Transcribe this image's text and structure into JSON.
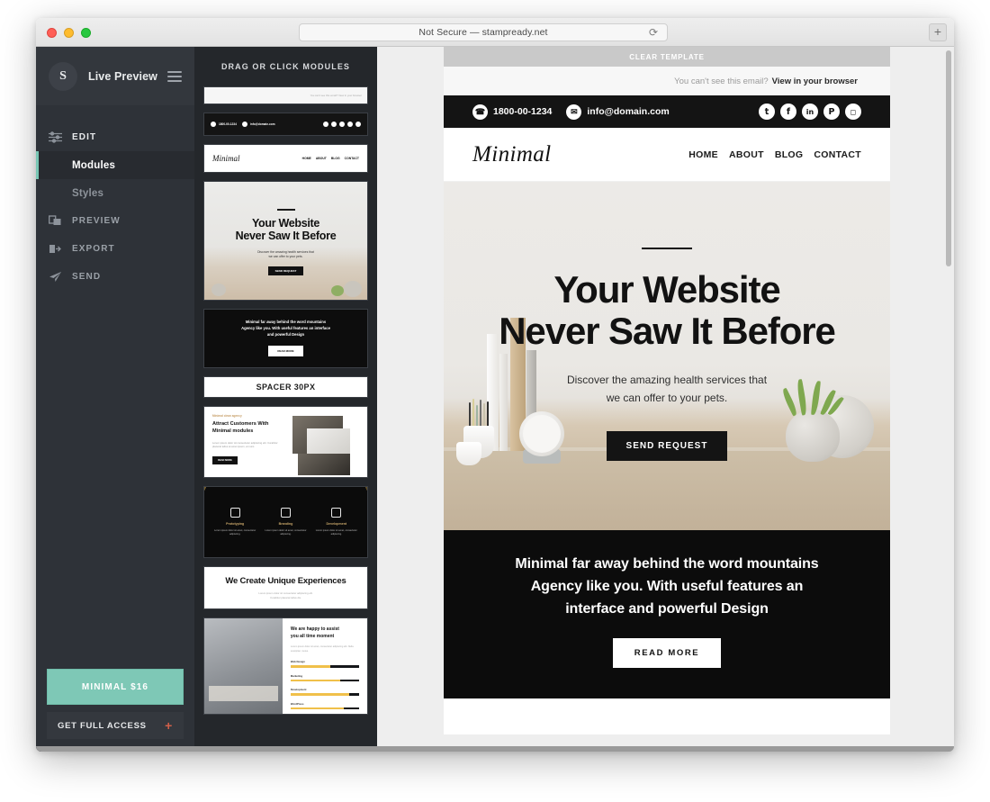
{
  "browser": {
    "url_text": "Not Secure — stampready.net",
    "reload_icon": "reload-icon",
    "newtab_label": "+"
  },
  "sidebar": {
    "brand": {
      "avatar_letter": "S",
      "title": "Live Preview",
      "menu_icon": "hamburger-icon"
    },
    "nav": [
      {
        "label": "EDIT",
        "icon": "sliders-icon",
        "type": "head"
      },
      {
        "label": "Modules",
        "type": "sub",
        "active": true
      },
      {
        "label": "Styles",
        "type": "sub",
        "active": false
      },
      {
        "label": "PREVIEW",
        "icon": "window-icon",
        "type": "head"
      },
      {
        "label": "EXPORT",
        "icon": "export-icon",
        "type": "head"
      },
      {
        "label": "SEND",
        "icon": "paper-plane-icon",
        "type": "head"
      }
    ],
    "plan_button": "MINIMAL $16",
    "full_access": {
      "label": "GET FULL ACCESS",
      "plus": "+"
    },
    "accent_color": "#7ec8b6",
    "plus_color": "#d1604a"
  },
  "modules_panel": {
    "title": "DRAG OR CLICK MODULES",
    "items": [
      {
        "type": "browser-bar",
        "text": "You can't see this email? View in your browser"
      },
      {
        "type": "contact-bar",
        "phone": "1800-00-1234",
        "email": "info@domain.com"
      },
      {
        "type": "nav-bar",
        "logo": "Minimal",
        "links": [
          "HOME",
          "ABOUT",
          "BLOG",
          "CONTACT"
        ]
      },
      {
        "type": "hero",
        "title_line1": "Your Website",
        "title_line2": "Never Saw It Before",
        "sub_line1": "Discover the amazing health services that",
        "sub_line2": "we can offer to your pets.",
        "cta": "SEND REQUEST"
      },
      {
        "type": "promo",
        "line1": "Minimal far away behind the word mountains",
        "line2": "Agency like you. With useful features an interface",
        "line3": "and powerful Design",
        "cta": "READ MORE"
      },
      {
        "type": "spacer",
        "label": "SPACER 30PX"
      },
      {
        "type": "feature",
        "eyebrow": "Minimal clean agency",
        "title_line1": "Attract Customers With",
        "title_line2": "Minimal modules",
        "body": "Lorem ipsum dolor sit consectetur adipiscing elit. Curabitur placerat tellus at amet ipsum, at nunc.",
        "cta": "READ MORE"
      },
      {
        "type": "services",
        "cards": [
          {
            "title": "Prototyping",
            "body": "Lorem ipsum dolor sit amet, consectetur adipiscing."
          },
          {
            "title": "Branding",
            "body": "Lorem ipsum dolor sit amet, consectetur adipiscing."
          },
          {
            "title": "Development",
            "body": "Lorem ipsum dolor sit amet, consectetur adipiscing."
          }
        ]
      },
      {
        "type": "experience",
        "title": "We Create Unique Experiences",
        "body_line1": "Lorem ipsum dolor sit consectetur adipiscing elit.",
        "body_line2": "Curabitur placerat tellus dis."
      },
      {
        "type": "skills",
        "title_line1": "We are happy to assist",
        "title_line2": "you all time moment",
        "body": "Lorem ipsum dolor sit amet, consectetur adipiscing elit. Nulla suscipitar, metus.",
        "bars": [
          {
            "label": "Web Design",
            "value": 58
          },
          {
            "label": "Marketing",
            "value": 72
          },
          {
            "label": "Development",
            "value": 86
          },
          {
            "label": "WordPress",
            "value": 78
          }
        ]
      }
    ]
  },
  "email_preview": {
    "clear_template_label": "CLEAR TEMPLATE",
    "view_browser": {
      "prefix": "You can't see this email?",
      "link": "View in your browser"
    },
    "contact": {
      "phone": "1800-00-1234",
      "email": "info@domain.com",
      "phone_icon": "phone-icon",
      "email_icon": "envelope-icon",
      "socials": [
        {
          "name": "twitter-icon",
          "glyph": "t"
        },
        {
          "name": "facebook-icon",
          "glyph": "f"
        },
        {
          "name": "linkedin-icon",
          "glyph": "in"
        },
        {
          "name": "pinterest-icon",
          "glyph": "P"
        },
        {
          "name": "instagram-icon",
          "glyph": "◻"
        }
      ]
    },
    "nav": {
      "logo": "Minimal",
      "links": [
        "HOME",
        "ABOUT",
        "BLOG",
        "CONTACT"
      ]
    },
    "hero": {
      "title_line1": "Your Website",
      "title_line2": "Never Saw It Before",
      "sub_line1": "Discover the amazing health services that",
      "sub_line2": "we can offer to your pets.",
      "cta": "SEND REQUEST"
    },
    "promo": {
      "line1": "Minimal far away behind the word mountains",
      "line2": "Agency like you. With useful features an",
      "line3": "interface and powerful Design",
      "cta": "READ MORE"
    }
  }
}
